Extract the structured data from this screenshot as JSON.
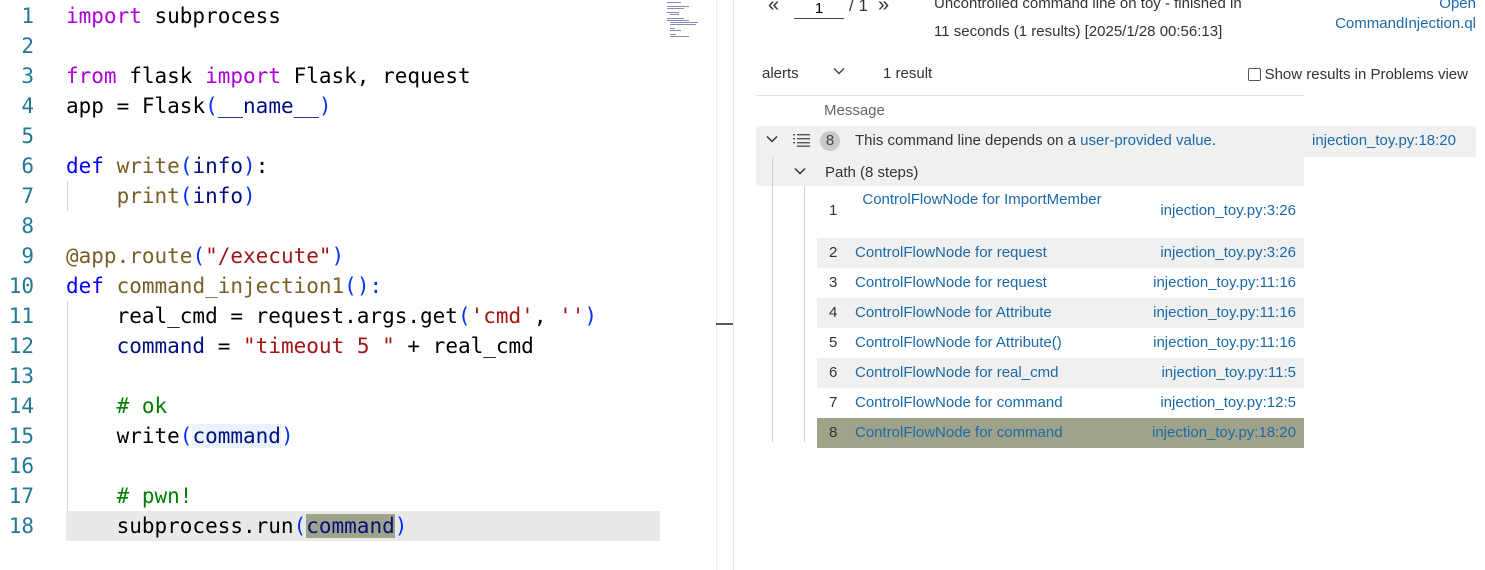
{
  "editor": {
    "lines": [
      {
        "n": "1",
        "tokens": [
          {
            "t": "import",
            "c": "k-import"
          },
          {
            "t": " subprocess",
            "c": "k-plain"
          }
        ]
      },
      {
        "n": "2",
        "tokens": []
      },
      {
        "n": "3",
        "tokens": [
          {
            "t": "from",
            "c": "k-import"
          },
          {
            "t": " flask ",
            "c": "k-plain"
          },
          {
            "t": "import",
            "c": "k-import"
          },
          {
            "t": " Flask, request",
            "c": "k-plain"
          }
        ]
      },
      {
        "n": "4",
        "tokens": [
          {
            "t": "app",
            "c": "k-plain"
          },
          {
            "t": " = Flask",
            "c": "k-plain"
          },
          {
            "t": "(",
            "c": "k-br1"
          },
          {
            "t": "__name__",
            "c": "k-var"
          },
          {
            "t": ")",
            "c": "k-br1"
          }
        ]
      },
      {
        "n": "5",
        "tokens": []
      },
      {
        "n": "6",
        "tokens": [
          {
            "t": "def",
            "c": "k-def"
          },
          {
            "t": " ",
            "c": "k-plain"
          },
          {
            "t": "write",
            "c": "k-fn"
          },
          {
            "t": "(",
            "c": "k-br1"
          },
          {
            "t": "info",
            "c": "k-var"
          },
          {
            "t": ")",
            "c": "k-br1"
          },
          {
            "t": ":",
            "c": "k-plain"
          }
        ]
      },
      {
        "n": "7",
        "tokens": [
          {
            "t": "    ",
            "c": "k-plain"
          },
          {
            "t": "print",
            "c": "k-fn"
          },
          {
            "t": "(",
            "c": "k-br1"
          },
          {
            "t": "info",
            "c": "k-var"
          },
          {
            "t": ")",
            "c": "k-br1"
          }
        ]
      },
      {
        "n": "8",
        "tokens": []
      },
      {
        "n": "9",
        "tokens": [
          {
            "t": "@app.route",
            "c": "k-dec"
          },
          {
            "t": "(",
            "c": "k-br1"
          },
          {
            "t": "\"/execute\"",
            "c": "k-str"
          },
          {
            "t": ")",
            "c": "k-br1"
          }
        ]
      },
      {
        "n": "10",
        "tokens": [
          {
            "t": "def",
            "c": "k-def"
          },
          {
            "t": " ",
            "c": "k-plain"
          },
          {
            "t": "command_injection1",
            "c": "k-fn"
          },
          {
            "t": "():",
            "c": "k-br1"
          }
        ]
      },
      {
        "n": "11",
        "tokens": [
          {
            "t": "    real_cmd = request.args.get",
            "c": "k-plain"
          },
          {
            "t": "(",
            "c": "k-br1"
          },
          {
            "t": "'cmd'",
            "c": "k-str"
          },
          {
            "t": ", ",
            "c": "k-plain"
          },
          {
            "t": "''",
            "c": "k-str"
          },
          {
            "t": ")",
            "c": "k-br1"
          }
        ]
      },
      {
        "n": "12",
        "tokens": [
          {
            "t": "    ",
            "c": "k-plain"
          },
          {
            "t": "command",
            "c": "k-var"
          },
          {
            "t": " = ",
            "c": "k-plain"
          },
          {
            "t": "\"timeout 5 \"",
            "c": "k-str"
          },
          {
            "t": " + real_cmd",
            "c": "k-plain"
          }
        ]
      },
      {
        "n": "13",
        "tokens": []
      },
      {
        "n": "14",
        "tokens": [
          {
            "t": "    ",
            "c": "k-plain"
          },
          {
            "t": "# ok",
            "c": "k-com"
          }
        ]
      },
      {
        "n": "15",
        "tokens": [
          {
            "t": "    write",
            "c": "k-plain"
          },
          {
            "t": "(",
            "c": "k-br1"
          },
          {
            "t": "command",
            "c": "k-var hl-ref"
          },
          {
            "t": ")",
            "c": "k-br1"
          }
        ]
      },
      {
        "n": "16",
        "tokens": []
      },
      {
        "n": "17",
        "tokens": [
          {
            "t": "    ",
            "c": "k-plain"
          },
          {
            "t": "# pwn!",
            "c": "k-com"
          }
        ]
      },
      {
        "n": "18",
        "tokens": [
          {
            "t": "    subprocess.run",
            "c": "k-plain"
          },
          {
            "t": "(",
            "c": "k-br1"
          },
          {
            "t": "command",
            "c": "k-var hl-sel"
          },
          {
            "t": ")",
            "c": "k-br1"
          }
        ]
      }
    ]
  },
  "results": {
    "pager": {
      "prev": "«",
      "page": "1",
      "total": "/ 1",
      "next": "»"
    },
    "status_line1": "Uncontrolled command line on toy - finished in",
    "status_line2": "11 seconds (1 results) [2025/1/28 00:56:13]",
    "open_query_line1": "Open",
    "open_query_line2": "CommandInjection.ql",
    "toolbar": {
      "alerts": "alerts",
      "count": "1 result",
      "problems": "Show results in Problems view"
    },
    "header_message": "Message",
    "alert": {
      "badge": "8",
      "text_before": "This command line depends on a ",
      "link": "user-provided value",
      "text_after": ".",
      "location": "injection_toy.py:18:20"
    },
    "path_label": "Path (8 steps)",
    "steps": [
      {
        "n": "1",
        "name": "ControlFlowNode for ImportMember",
        "loc": "injection_toy.py:3:26"
      },
      {
        "n": "2",
        "name": "ControlFlowNode for request",
        "loc": "injection_toy.py:3:26"
      },
      {
        "n": "3",
        "name": "ControlFlowNode for request",
        "loc": "injection_toy.py:11:16"
      },
      {
        "n": "4",
        "name": "ControlFlowNode for Attribute",
        "loc": "injection_toy.py:11:16"
      },
      {
        "n": "5",
        "name": "ControlFlowNode for Attribute()",
        "loc": "injection_toy.py:11:16"
      },
      {
        "n": "6",
        "name": "ControlFlowNode for real_cmd",
        "loc": "injection_toy.py:11:5"
      },
      {
        "n": "7",
        "name": "ControlFlowNode for command",
        "loc": "injection_toy.py:12:5"
      },
      {
        "n": "8",
        "name": "ControlFlowNode for command",
        "loc": "injection_toy.py:18:20"
      }
    ],
    "selected_step": 8
  },
  "icons": {
    "collapse": "chevron-down-icon",
    "list": "list-icon",
    "dropdown": "chevron-down-icon"
  }
}
